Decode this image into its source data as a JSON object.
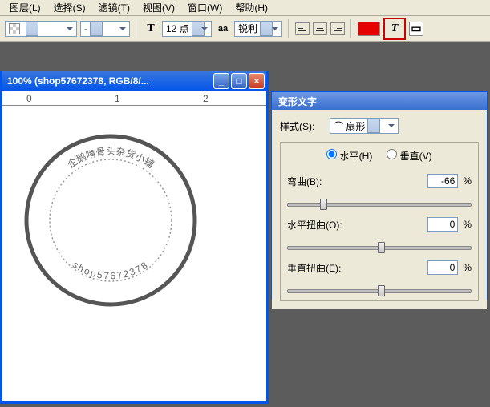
{
  "menu": {
    "layers": "图层(L)",
    "select": "选择(S)",
    "filter": "滤镜(T)",
    "view": "视图(V)",
    "window": "窗口(W)",
    "help": "帮助(H)"
  },
  "toolbar": {
    "font_size": "12 点",
    "aa_label": "锐利",
    "t_label": "T",
    "aa_prefix": "aa"
  },
  "doc": {
    "title": "100% (shop57672378, RGB/8/..."
  },
  "ruler": {
    "t0": "0",
    "t1": "1",
    "t2": "2"
  },
  "stamp": {
    "top_text": "企鹅啃骨头杂货小铺",
    "bottom_text": "shop57672378"
  },
  "panel": {
    "title": "变形文字",
    "style_label": "样式(S):",
    "style_value": "扇形",
    "horiz": "水平(H)",
    "vert": "垂直(V)",
    "bend_label": "弯曲(B):",
    "bend_value": "-66",
    "hdist_label": "水平扭曲(O):",
    "hdist_value": "0",
    "vdist_label": "垂直扭曲(E):",
    "vdist_value": "0",
    "pct": "%"
  },
  "chart_data": null
}
